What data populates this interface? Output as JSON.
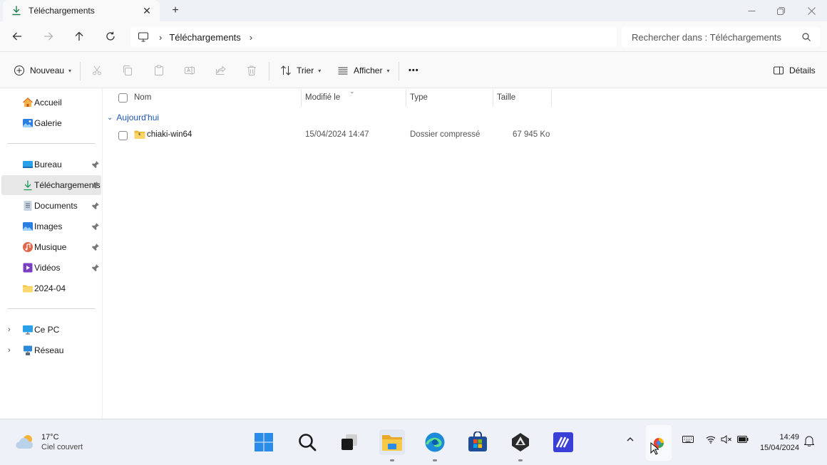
{
  "window": {
    "tab_title": "Téléchargements",
    "tab_close": "✕",
    "new_tab": "+"
  },
  "address": {
    "breadcrumb": "Téléchargements",
    "search_placeholder": "Rechercher dans : Téléchargements"
  },
  "toolbar": {
    "new_label": "Nouveau",
    "sort_label": "Trier",
    "view_label": "Afficher",
    "more_label": "•••",
    "details_label": "Détails"
  },
  "sidebar": {
    "top": [
      {
        "label": "Accueil"
      },
      {
        "label": "Galerie"
      }
    ],
    "quick": [
      {
        "label": "Bureau"
      },
      {
        "label": "Téléchargements"
      },
      {
        "label": "Documents"
      },
      {
        "label": "Images"
      },
      {
        "label": "Musique"
      },
      {
        "label": "Vidéos"
      },
      {
        "label": "2024-04"
      }
    ],
    "devices": [
      {
        "label": "Ce PC"
      },
      {
        "label": "Réseau"
      }
    ]
  },
  "columns": {
    "name": "Nom",
    "modified": "Modifié le",
    "type": "Type",
    "size": "Taille"
  },
  "group": {
    "label": "Aujourd'hui"
  },
  "files": [
    {
      "name": "chiaki-win64",
      "modified": "15/04/2024 14:47",
      "type": "Dossier compressé",
      "size": "67 945 Ko"
    }
  ],
  "taskbar": {
    "weather_temp": "17°C",
    "weather_desc": "Ciel couvert",
    "time": "14:49",
    "date": "15/04/2024"
  },
  "colors": {
    "accent": "#0f6cbd",
    "folder": "#f7c948",
    "group_text": "#1f56b3"
  }
}
